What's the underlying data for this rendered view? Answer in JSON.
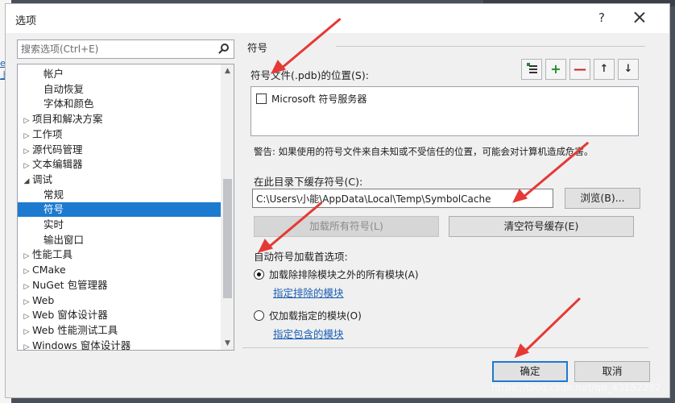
{
  "window": {
    "title": "选项",
    "help_label": "?"
  },
  "search": {
    "placeholder": "搜索选项(Ctrl+E)"
  },
  "tree": {
    "items": [
      {
        "label": "帐户",
        "level": 1,
        "expander": ""
      },
      {
        "label": "自动恢复",
        "level": 1,
        "expander": ""
      },
      {
        "label": "字体和颜色",
        "level": 1,
        "expander": ""
      },
      {
        "label": "项目和解决方案",
        "level": 0,
        "expander": "▷"
      },
      {
        "label": "工作项",
        "level": 0,
        "expander": "▷"
      },
      {
        "label": "源代码管理",
        "level": 0,
        "expander": "▷"
      },
      {
        "label": "文本编辑器",
        "level": 0,
        "expander": "▷"
      },
      {
        "label": "调试",
        "level": 0,
        "expander": "◢"
      },
      {
        "label": "常规",
        "level": 1,
        "expander": ""
      },
      {
        "label": "符号",
        "level": 1,
        "expander": "",
        "selected": true
      },
      {
        "label": "实时",
        "level": 1,
        "expander": ""
      },
      {
        "label": "输出窗口",
        "level": 1,
        "expander": ""
      },
      {
        "label": "性能工具",
        "level": 0,
        "expander": "▷"
      },
      {
        "label": "CMake",
        "level": 0,
        "expander": "▷"
      },
      {
        "label": "NuGet 包管理器",
        "level": 0,
        "expander": "▷"
      },
      {
        "label": "Web",
        "level": 0,
        "expander": "▷"
      },
      {
        "label": "Web 窗体设计器",
        "level": 0,
        "expander": "▷"
      },
      {
        "label": "Web 性能测试工具",
        "level": 0,
        "expander": "▷"
      },
      {
        "label": "Windows 窗体设计器",
        "level": 0,
        "expander": "▷"
      }
    ]
  },
  "symbols": {
    "group_title": "符号",
    "locations_label": "符号文件(.pdb)的位置(S):",
    "ms_server_label": "Microsoft 符号服务器",
    "warning": "警告: 如果使用的符号文件来自未知或不受信任的位置，可能会对计算机造成危害。",
    "cache_label": "在此目录下缓存符号(C):",
    "cache_path": "C:\\Users\\小能\\AppData\\Local\\Temp\\SymbolCache",
    "browse_label": "浏览(B)...",
    "load_all_label": "加载所有符号(L)",
    "clear_cache_label": "清空符号缓存(E)",
    "auto_load_label": "自动符号加载首选项:",
    "option_all_label": "加载除排除模块之外的所有模块(A)",
    "specify_excluded_link": "指定排除的模块",
    "option_specified_label": "仅加载指定的模块(O)",
    "specify_included_link": "指定包含的模块"
  },
  "toolbar": {
    "add_label": "+",
    "remove_label": "—",
    "up_label": "↑",
    "down_label": "↓"
  },
  "footer": {
    "ok_label": "确定",
    "cancel_label": "取消"
  },
  "colors": {
    "accent": "#1c7ad0",
    "annotation_arrow": "#e53935",
    "green": "#1d8c2e",
    "red": "#c62828"
  },
  "watermark": "https://blog.csdn.net/qq_43152292",
  "background": {
    "left_link": "e 上"
  }
}
